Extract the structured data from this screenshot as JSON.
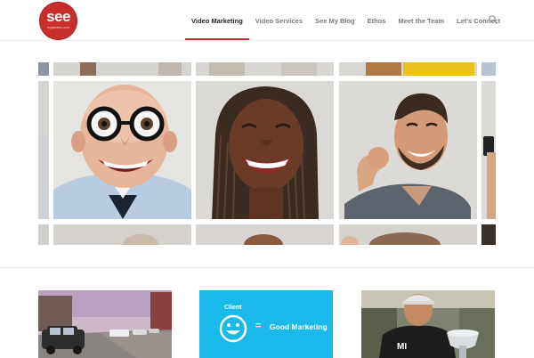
{
  "site": {
    "logo_word": "see",
    "logo_sub": "mystores.com",
    "brand_color": "#c62f2c"
  },
  "nav": {
    "items": [
      {
        "label": "Video Marketing",
        "active": true
      },
      {
        "label": "Video Services",
        "active": false
      },
      {
        "label": "See My Blog",
        "active": false
      },
      {
        "label": "Ethos",
        "active": false
      },
      {
        "label": "Meet the Team",
        "active": false
      },
      {
        "label": "Let's Connect",
        "active": false
      }
    ],
    "search_icon": "search-icon"
  },
  "photo_wall": {
    "tiles": [
      {
        "subject": "bald-man-glasses"
      },
      {
        "subject": "woman-braids-laughing"
      },
      {
        "subject": "man-fist-pump"
      }
    ]
  },
  "cards": {
    "middle": {
      "client_label": "Client",
      "equals": "=",
      "result_label": "Good Marketing"
    }
  }
}
